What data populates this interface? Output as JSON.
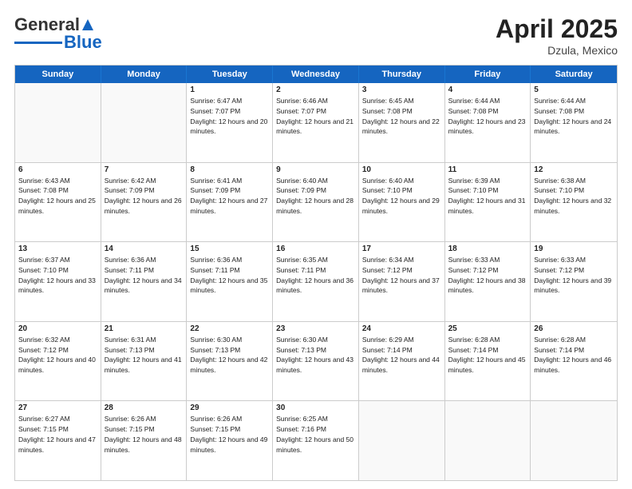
{
  "header": {
    "logo_general": "General",
    "logo_blue": "Blue",
    "month_year": "April 2025",
    "location": "Dzula, Mexico"
  },
  "days_of_week": [
    "Sunday",
    "Monday",
    "Tuesday",
    "Wednesday",
    "Thursday",
    "Friday",
    "Saturday"
  ],
  "weeks": [
    [
      {
        "day": "",
        "sunrise": "",
        "sunset": "",
        "daylight": ""
      },
      {
        "day": "",
        "sunrise": "",
        "sunset": "",
        "daylight": ""
      },
      {
        "day": "1",
        "sunrise": "Sunrise: 6:47 AM",
        "sunset": "Sunset: 7:07 PM",
        "daylight": "Daylight: 12 hours and 20 minutes."
      },
      {
        "day": "2",
        "sunrise": "Sunrise: 6:46 AM",
        "sunset": "Sunset: 7:07 PM",
        "daylight": "Daylight: 12 hours and 21 minutes."
      },
      {
        "day": "3",
        "sunrise": "Sunrise: 6:45 AM",
        "sunset": "Sunset: 7:08 PM",
        "daylight": "Daylight: 12 hours and 22 minutes."
      },
      {
        "day": "4",
        "sunrise": "Sunrise: 6:44 AM",
        "sunset": "Sunset: 7:08 PM",
        "daylight": "Daylight: 12 hours and 23 minutes."
      },
      {
        "day": "5",
        "sunrise": "Sunrise: 6:44 AM",
        "sunset": "Sunset: 7:08 PM",
        "daylight": "Daylight: 12 hours and 24 minutes."
      }
    ],
    [
      {
        "day": "6",
        "sunrise": "Sunrise: 6:43 AM",
        "sunset": "Sunset: 7:08 PM",
        "daylight": "Daylight: 12 hours and 25 minutes."
      },
      {
        "day": "7",
        "sunrise": "Sunrise: 6:42 AM",
        "sunset": "Sunset: 7:09 PM",
        "daylight": "Daylight: 12 hours and 26 minutes."
      },
      {
        "day": "8",
        "sunrise": "Sunrise: 6:41 AM",
        "sunset": "Sunset: 7:09 PM",
        "daylight": "Daylight: 12 hours and 27 minutes."
      },
      {
        "day": "9",
        "sunrise": "Sunrise: 6:40 AM",
        "sunset": "Sunset: 7:09 PM",
        "daylight": "Daylight: 12 hours and 28 minutes."
      },
      {
        "day": "10",
        "sunrise": "Sunrise: 6:40 AM",
        "sunset": "Sunset: 7:10 PM",
        "daylight": "Daylight: 12 hours and 29 minutes."
      },
      {
        "day": "11",
        "sunrise": "Sunrise: 6:39 AM",
        "sunset": "Sunset: 7:10 PM",
        "daylight": "Daylight: 12 hours and 31 minutes."
      },
      {
        "day": "12",
        "sunrise": "Sunrise: 6:38 AM",
        "sunset": "Sunset: 7:10 PM",
        "daylight": "Daylight: 12 hours and 32 minutes."
      }
    ],
    [
      {
        "day": "13",
        "sunrise": "Sunrise: 6:37 AM",
        "sunset": "Sunset: 7:10 PM",
        "daylight": "Daylight: 12 hours and 33 minutes."
      },
      {
        "day": "14",
        "sunrise": "Sunrise: 6:36 AM",
        "sunset": "Sunset: 7:11 PM",
        "daylight": "Daylight: 12 hours and 34 minutes."
      },
      {
        "day": "15",
        "sunrise": "Sunrise: 6:36 AM",
        "sunset": "Sunset: 7:11 PM",
        "daylight": "Daylight: 12 hours and 35 minutes."
      },
      {
        "day": "16",
        "sunrise": "Sunrise: 6:35 AM",
        "sunset": "Sunset: 7:11 PM",
        "daylight": "Daylight: 12 hours and 36 minutes."
      },
      {
        "day": "17",
        "sunrise": "Sunrise: 6:34 AM",
        "sunset": "Sunset: 7:12 PM",
        "daylight": "Daylight: 12 hours and 37 minutes."
      },
      {
        "day": "18",
        "sunrise": "Sunrise: 6:33 AM",
        "sunset": "Sunset: 7:12 PM",
        "daylight": "Daylight: 12 hours and 38 minutes."
      },
      {
        "day": "19",
        "sunrise": "Sunrise: 6:33 AM",
        "sunset": "Sunset: 7:12 PM",
        "daylight": "Daylight: 12 hours and 39 minutes."
      }
    ],
    [
      {
        "day": "20",
        "sunrise": "Sunrise: 6:32 AM",
        "sunset": "Sunset: 7:12 PM",
        "daylight": "Daylight: 12 hours and 40 minutes."
      },
      {
        "day": "21",
        "sunrise": "Sunrise: 6:31 AM",
        "sunset": "Sunset: 7:13 PM",
        "daylight": "Daylight: 12 hours and 41 minutes."
      },
      {
        "day": "22",
        "sunrise": "Sunrise: 6:30 AM",
        "sunset": "Sunset: 7:13 PM",
        "daylight": "Daylight: 12 hours and 42 minutes."
      },
      {
        "day": "23",
        "sunrise": "Sunrise: 6:30 AM",
        "sunset": "Sunset: 7:13 PM",
        "daylight": "Daylight: 12 hours and 43 minutes."
      },
      {
        "day": "24",
        "sunrise": "Sunrise: 6:29 AM",
        "sunset": "Sunset: 7:14 PM",
        "daylight": "Daylight: 12 hours and 44 minutes."
      },
      {
        "day": "25",
        "sunrise": "Sunrise: 6:28 AM",
        "sunset": "Sunset: 7:14 PM",
        "daylight": "Daylight: 12 hours and 45 minutes."
      },
      {
        "day": "26",
        "sunrise": "Sunrise: 6:28 AM",
        "sunset": "Sunset: 7:14 PM",
        "daylight": "Daylight: 12 hours and 46 minutes."
      }
    ],
    [
      {
        "day": "27",
        "sunrise": "Sunrise: 6:27 AM",
        "sunset": "Sunset: 7:15 PM",
        "daylight": "Daylight: 12 hours and 47 minutes."
      },
      {
        "day": "28",
        "sunrise": "Sunrise: 6:26 AM",
        "sunset": "Sunset: 7:15 PM",
        "daylight": "Daylight: 12 hours and 48 minutes."
      },
      {
        "day": "29",
        "sunrise": "Sunrise: 6:26 AM",
        "sunset": "Sunset: 7:15 PM",
        "daylight": "Daylight: 12 hours and 49 minutes."
      },
      {
        "day": "30",
        "sunrise": "Sunrise: 6:25 AM",
        "sunset": "Sunset: 7:16 PM",
        "daylight": "Daylight: 12 hours and 50 minutes."
      },
      {
        "day": "",
        "sunrise": "",
        "sunset": "",
        "daylight": ""
      },
      {
        "day": "",
        "sunrise": "",
        "sunset": "",
        "daylight": ""
      },
      {
        "day": "",
        "sunrise": "",
        "sunset": "",
        "daylight": ""
      }
    ]
  ]
}
